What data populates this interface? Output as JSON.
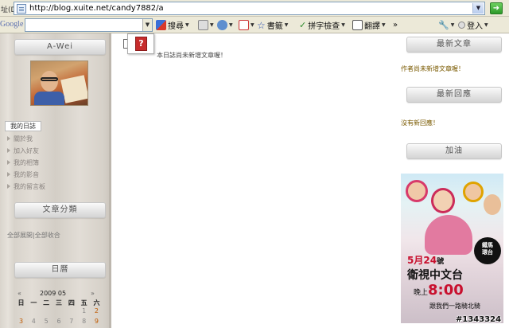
{
  "address_bar": {
    "label": "址(D)",
    "url": "http://blog.xuite.net/candy7882/a"
  },
  "google_toolbar": {
    "logo": "Google",
    "search_label": "搜尋",
    "bookmarks_label": "書籤",
    "spellcheck_label": "拼字檢查",
    "translate_label": "翻譯",
    "more_label": "»",
    "login_label": "登入"
  },
  "left_sidebar": {
    "profile_title": "A-Wei",
    "my_diary_tab": "我的日誌",
    "nav_items": [
      {
        "label": "關於我"
      },
      {
        "label": "加入好友"
      },
      {
        "label": "我的相簿"
      },
      {
        "label": "我的影音"
      },
      {
        "label": "我的留言板"
      }
    ],
    "categories_title": "文章分類",
    "expand_all": "全部展開",
    "separator": "|",
    "collapse_all": "全部收合",
    "calendar_title": "日曆",
    "calendar": {
      "prev": "«",
      "month": "2009 05",
      "next": "»",
      "weekdays": [
        "日",
        "一",
        "二",
        "三",
        "四",
        "五",
        "六"
      ],
      "first_row": [
        "",
        "",
        "",
        "",
        "",
        "1",
        "2"
      ],
      "second_row": [
        "3",
        "4",
        "5",
        "6",
        "7",
        "8",
        "9"
      ]
    }
  },
  "main": {
    "empty_message": "本日誌尚未新增文章喔！"
  },
  "right_sidebar": {
    "latest_articles_title": "最新文章",
    "latest_articles_text": "作者尚未新增文章喔！",
    "latest_replies_title": "最新回應",
    "latest_replies_text": "沒有新回應！",
    "cheer_title": "加油"
  },
  "ad": {
    "badge_line1": "鐵馬",
    "badge_line2": "環台",
    "date_month": "5月",
    "date_day": "24",
    "date_suffix": "號",
    "channel": "衛視中文台",
    "time_prefix": "晚上",
    "time": "8:00",
    "slogan": "跟我們一路騎北騎"
  },
  "watermark": "#1343324",
  "colors": {
    "toolbar_bg": "#ece9d8",
    "sidebar_text": "#7a5a00",
    "ad_red": "#c8102e"
  }
}
